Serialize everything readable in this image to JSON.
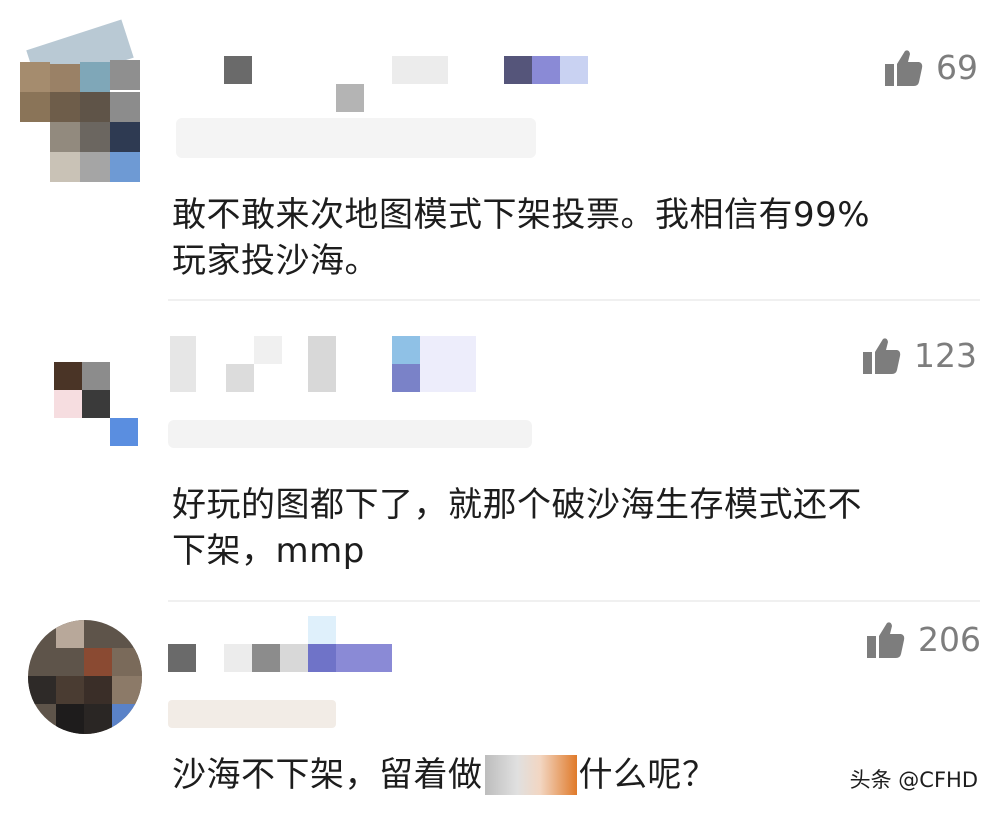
{
  "comments": [
    {
      "likes": "69",
      "text_line1": "敢不敢来次地图模式下架投票。我相信有99%",
      "text_line2": "玩家投沙海。"
    },
    {
      "likes": "123",
      "text_line1": "好玩的图都下了，就那个破沙海生存模式还不",
      "text_line2": "下架，mmp"
    },
    {
      "likes": "206",
      "text_line1": "沙海不下架，留着做",
      "text_line2": "什么呢？"
    }
  ],
  "icons": {
    "like": "thumbs-up-icon"
  },
  "colors": {
    "like_gray": "#7d7d7d",
    "text": "#1d1d1d",
    "divider": "#f0f0f0",
    "mosaic_blue": "#8a8ad6"
  },
  "watermark": "头条 @CFHD"
}
